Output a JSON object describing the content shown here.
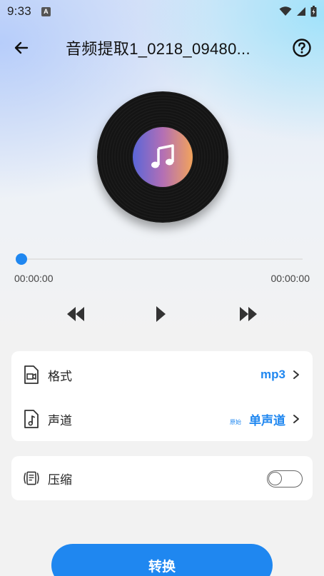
{
  "status_bar": {
    "time": "9:33",
    "notification_icon": "a-letter-icon",
    "right_icons": [
      "wifi-icon",
      "signal-icon",
      "battery-icon"
    ]
  },
  "header": {
    "title": "音频提取1_0218_09480...",
    "back_icon": "arrow-left-icon",
    "help_icon": "help-circle-icon"
  },
  "player": {
    "current_time": "00:00:00",
    "total_time": "00:00:00",
    "progress": 0,
    "controls": [
      "rewind-icon",
      "play-icon",
      "fast-forward-icon"
    ]
  },
  "settings": {
    "format": {
      "label": "格式",
      "value": "mp3"
    },
    "channel": {
      "label": "声道",
      "sub_label": "原始",
      "value": "单声道"
    },
    "compress": {
      "label": "压缩",
      "enabled": false
    }
  },
  "actions": {
    "convert_label": "转换"
  },
  "colors": {
    "accent": "#1f87f0",
    "background": "#f2f2f2",
    "card": "#ffffff",
    "text": "#222222"
  }
}
